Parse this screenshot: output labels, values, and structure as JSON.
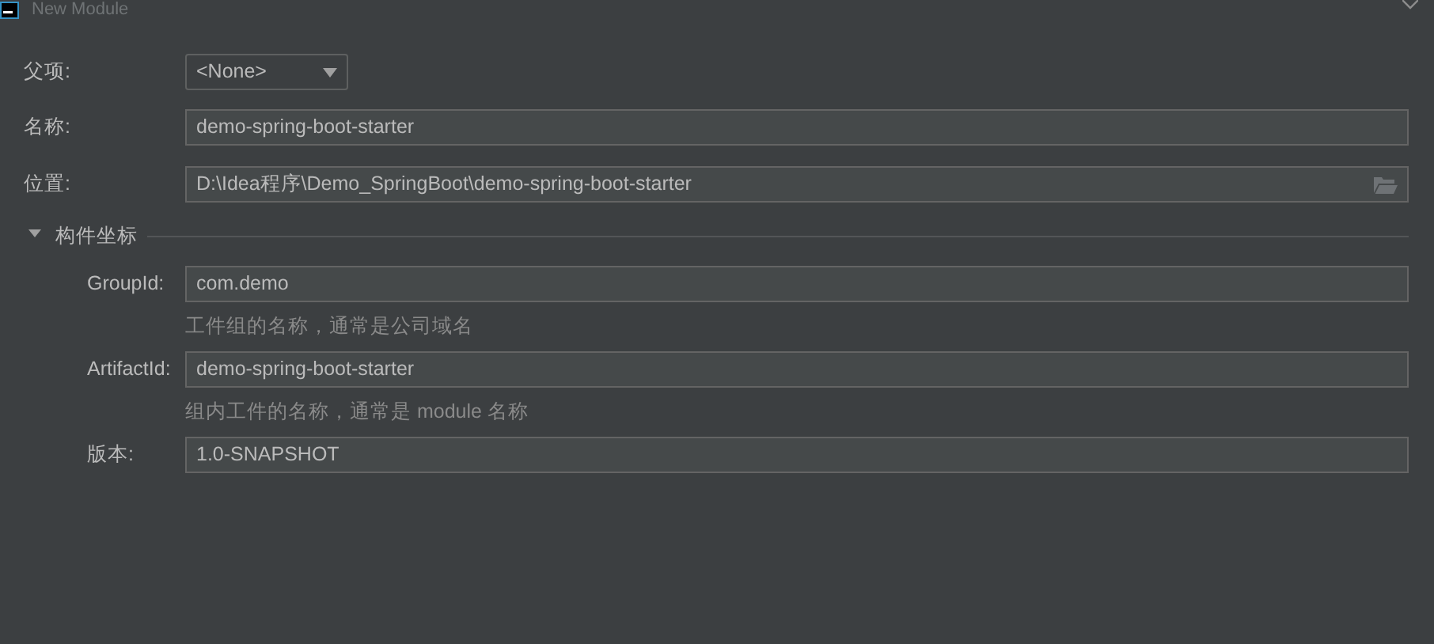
{
  "window": {
    "title": "New Module"
  },
  "parent": {
    "label": "父项:",
    "value": "<None>"
  },
  "name": {
    "label": "名称:",
    "value": "demo-spring-boot-starter"
  },
  "location": {
    "label": "位置:",
    "value": "D:\\Idea程序\\Demo_SpringBoot\\demo-spring-boot-starter"
  },
  "section": {
    "title": "构件坐标",
    "expanded": true,
    "fields": [
      {
        "label": "GroupId:",
        "value": "com.demo",
        "hint": "工件组的名称，通常是公司域名"
      },
      {
        "label": "ArtifactId:",
        "value": "demo-spring-boot-starter",
        "hint": "组内工件的名称，通常是 module 名称"
      },
      {
        "label": "版本:",
        "value": "1.0-SNAPSHOT"
      }
    ]
  }
}
